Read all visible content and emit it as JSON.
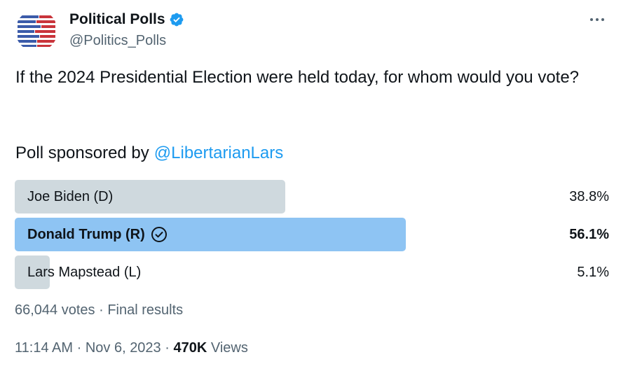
{
  "account": {
    "name": "Political Polls",
    "handle": "@Politics_Polls",
    "verified": true,
    "avatar_icon": "us-flag-stripes-icon"
  },
  "tweet": {
    "text": "If the 2024 Presidential Election were held today, for whom would you vote?",
    "sponsor_prefix": "Poll sponsored by",
    "sponsor_link": "@LibertarianLars"
  },
  "poll": {
    "options": [
      {
        "label": "Joe Biden (D)",
        "percent_text": "38.8%",
        "percent": 38.8,
        "winner": false
      },
      {
        "label": "Donald Trump (R)",
        "percent_text": "56.1%",
        "percent": 56.1,
        "winner": true
      },
      {
        "label": "Lars Mapstead (L)",
        "percent_text": "5.1%",
        "percent": 5.1,
        "winner": false
      }
    ],
    "votes": "66,044 votes",
    "separator": "·",
    "status": "Final results"
  },
  "meta": {
    "time": "11:14 AM",
    "separator": "·",
    "date": "Nov 6, 2023",
    "views_count": "470K",
    "views_label": "Views"
  },
  "colors": {
    "accent": "#1d9bf0",
    "bar_default": "#cfd9de",
    "bar_winner": "#8ec4f3",
    "text_secondary": "#536471"
  }
}
